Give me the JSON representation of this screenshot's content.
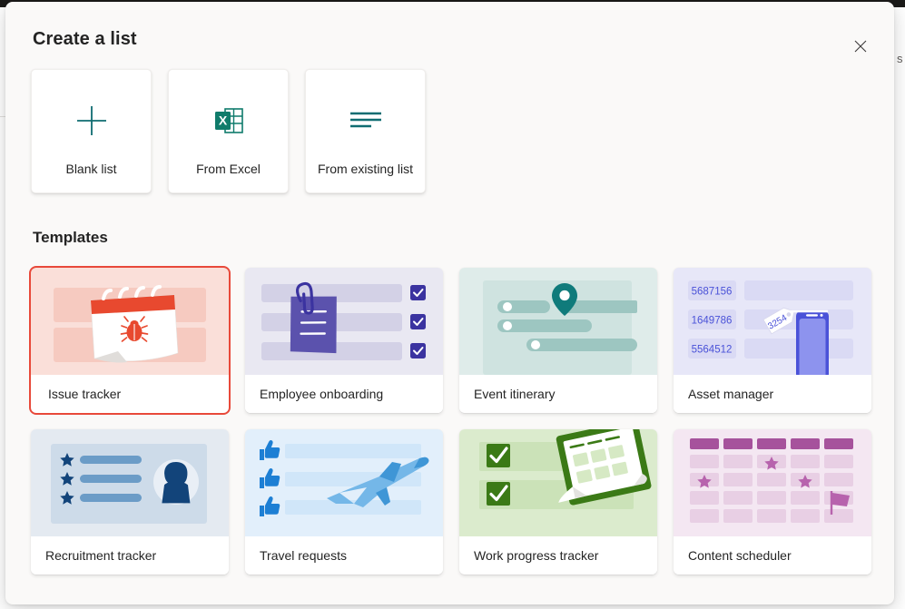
{
  "dialog": {
    "title": "Create a list",
    "close_icon": "close-icon",
    "close_label": "Close"
  },
  "background_page": {
    "edge_text": "s"
  },
  "create_options": [
    {
      "label": "Blank list",
      "icon": "plus-icon"
    },
    {
      "label": "From Excel",
      "icon": "excel-icon"
    },
    {
      "label": "From existing list",
      "icon": "lines-icon"
    }
  ],
  "templates_section": {
    "heading": "Templates"
  },
  "templates": [
    {
      "label": "Issue tracker",
      "art": "issue-tracker-art",
      "selected": true,
      "bg": "#fadfd9",
      "accent": "#e8493a"
    },
    {
      "label": "Employee onboarding",
      "art": "employee-onboarding-art",
      "selected": false,
      "bg": "#e9e8f2",
      "accent": "#4b3f9e"
    },
    {
      "label": "Event itinerary",
      "art": "event-itinerary-art",
      "selected": false,
      "bg": "#dfecea",
      "accent": "#0f7b7b"
    },
    {
      "label": "Asset manager",
      "art": "asset-manager-art",
      "selected": false,
      "bg": "#e7e7f8",
      "accent": "#4a52d8",
      "asset_ids": [
        "5687156",
        "1649786",
        "5564512"
      ],
      "tag_number": "3254"
    },
    {
      "label": "Recruitment tracker",
      "art": "recruitment-tracker-art",
      "selected": false,
      "bg": "#e4eaf1",
      "accent": "#12447a"
    },
    {
      "label": "Travel requests",
      "art": "travel-requests-art",
      "selected": false,
      "bg": "#e2effb",
      "accent": "#1d7fd4"
    },
    {
      "label": "Work progress tracker",
      "art": "work-progress-tracker-art",
      "selected": false,
      "bg": "#dbebcd",
      "accent": "#3b7a16"
    },
    {
      "label": "Content scheduler",
      "art": "content-scheduler-art",
      "selected": false,
      "bg": "#f4e7f2",
      "accent": "#a6529c"
    }
  ],
  "selection_highlight": {
    "color": "#e8493a",
    "target": "Issue tracker"
  }
}
